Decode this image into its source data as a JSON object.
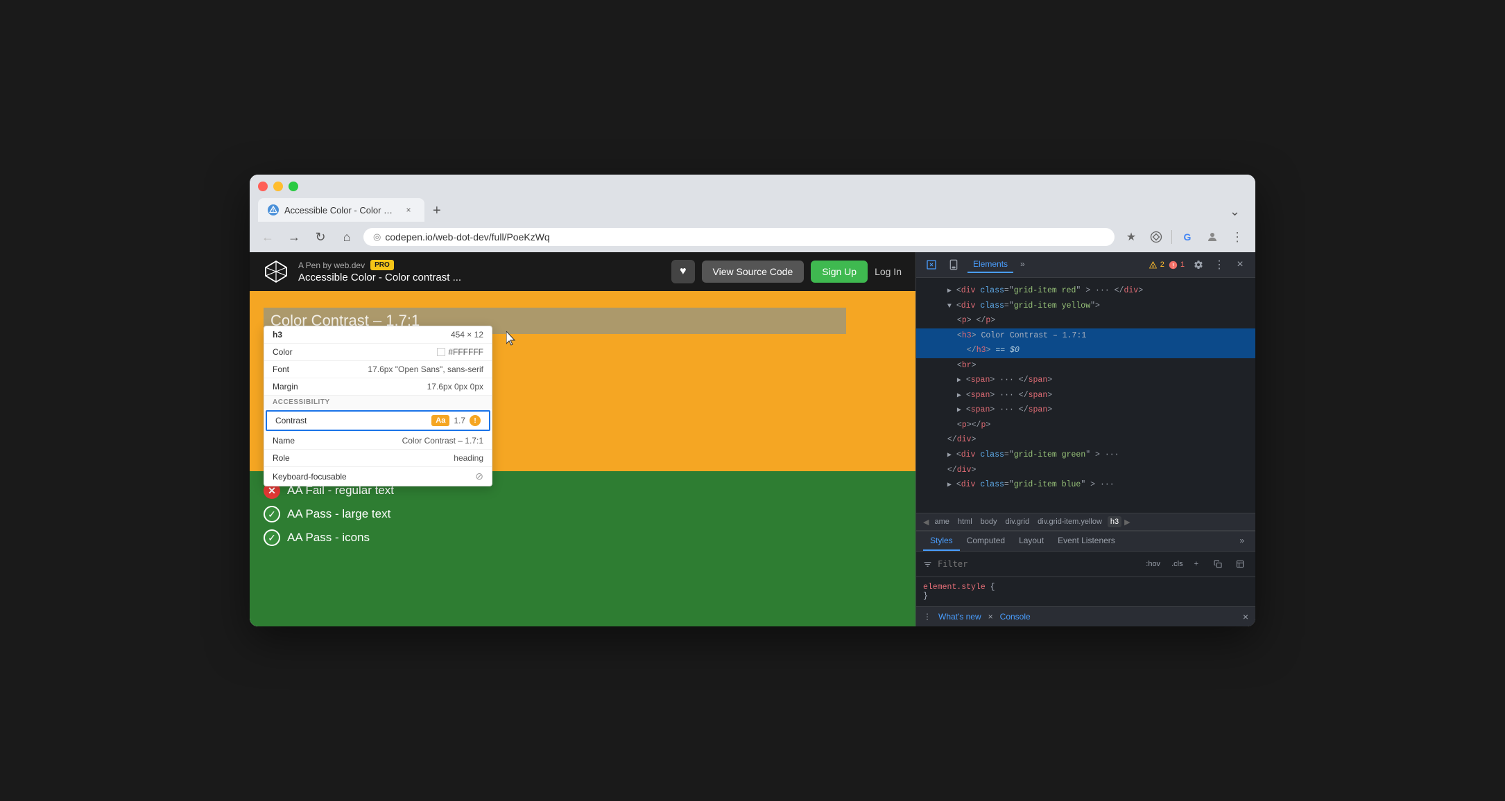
{
  "browser": {
    "tab_title": "Accessible Color - Color cont...",
    "tab_icon": "●",
    "url": "codepen.io/web-dot-dev/full/PoeKzWq",
    "new_tab_label": "+",
    "expand_label": "⌄"
  },
  "nav": {
    "back_label": "←",
    "forward_label": "→",
    "refresh_label": "↻",
    "home_label": "⌂",
    "address_icon": "⊙",
    "star_label": "☆",
    "extensions_label": "⬡",
    "google_label": "G",
    "avatar_label": "👤",
    "menu_label": "⋮"
  },
  "codepen": {
    "author": "A Pen by web.dev",
    "pro_label": "PRO",
    "pen_title": "Accessible Color - Color contrast ...",
    "heart_icon": "♥",
    "view_source_label": "View Source Code",
    "signup_label": "Sign Up",
    "login_label": "Log In"
  },
  "demo": {
    "heading": "Color Contrast – 1.7:1",
    "yellow_bg": "#f5a623",
    "green_bg": "#2e7d32",
    "aa_items": [
      {
        "status": "fail",
        "label": "AA Fail - regular text"
      },
      {
        "status": "pass",
        "label": "AA Pass - large text"
      },
      {
        "status": "pass",
        "label": "AA Pass - icons"
      }
    ]
  },
  "inspector": {
    "element_label": "h3",
    "dimensions": "454 × 12",
    "color_label": "Color",
    "color_value": "#FFFFFF",
    "font_label": "Font",
    "font_value": "17.6px \"Open Sans\", sans-serif",
    "margin_label": "Margin",
    "margin_value": "17.6px 0px 0px",
    "accessibility_header": "ACCESSIBILITY",
    "contrast_label": "Contrast",
    "contrast_aa_badge": "Aa",
    "contrast_value": "1.7",
    "name_label": "Name",
    "name_value": "Color Contrast – 1.7:1",
    "role_label": "Role",
    "role_value": "heading",
    "keyboard_label": "Keyboard-focusable",
    "keyboard_value": "⊘"
  },
  "devtools": {
    "toolbar_icon_inspect": "⊡",
    "toolbar_icon_device": "▣",
    "tab_elements": "Elements",
    "tab_more": "»",
    "alert_count": "2",
    "error_count": "1",
    "settings_icon": "⚙",
    "more_icon": "⋮",
    "close_icon": "×",
    "tree": [
      {
        "indent": 2,
        "expanded": true,
        "content": "<div class=\"grid-item red\"> ··· </div>",
        "selected": false
      },
      {
        "indent": 2,
        "expanded": true,
        "content": "<div class=\"grid-item yellow\">",
        "selected": false
      },
      {
        "indent": 3,
        "expanded": false,
        "content": "<p> </p>",
        "selected": false
      },
      {
        "indent": 3,
        "expanded": false,
        "content": "<h3>Color Contrast – 1.7:1",
        "selected": true
      },
      {
        "indent": 4,
        "expanded": false,
        "content": "</h3> == $0",
        "selected": true
      },
      {
        "indent": 3,
        "expanded": false,
        "content": "<br>",
        "selected": false
      },
      {
        "indent": 3,
        "expanded": true,
        "content": "<span> ··· </span>",
        "selected": false
      },
      {
        "indent": 3,
        "expanded": true,
        "content": "<span> ··· </span>",
        "selected": false
      },
      {
        "indent": 3,
        "expanded": true,
        "content": "<span> ··· </span>",
        "selected": false
      },
      {
        "indent": 3,
        "expanded": false,
        "content": "<p></p>",
        "selected": false
      },
      {
        "indent": 2,
        "expanded": false,
        "content": "</div>",
        "selected": false
      },
      {
        "indent": 2,
        "expanded": true,
        "content": "<div class=\"grid-item green\"> ···",
        "selected": false
      },
      {
        "indent": 2,
        "expanded": false,
        "content": "</div>",
        "selected": false
      },
      {
        "indent": 2,
        "expanded": true,
        "content": "<div class=\"grid-item blue\"> ···",
        "selected": false
      }
    ],
    "breadcrumb": [
      {
        "label": "ame",
        "active": false
      },
      {
        "label": "html",
        "active": false
      },
      {
        "label": "body",
        "active": false
      },
      {
        "label": "div.grid",
        "active": false
      },
      {
        "label": "div.grid-item.yellow",
        "active": false
      },
      {
        "label": "h3",
        "active": true
      }
    ],
    "style_tabs": [
      "Styles",
      "Computed",
      "Layout",
      "Event Listeners",
      "»"
    ],
    "filter_placeholder": "Filter",
    "filter_hov": ":hov",
    "filter_cls": ".cls",
    "filter_plus": "+",
    "element_style": "element.style {",
    "element_style_close": "}",
    "bottom_label": "What's new",
    "console_label": "Console"
  }
}
